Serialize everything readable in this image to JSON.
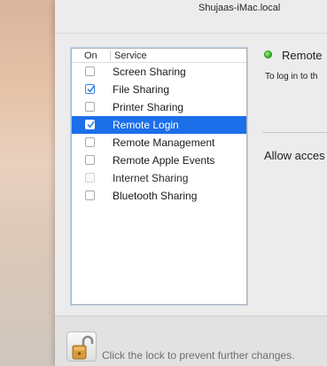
{
  "window": {
    "hostname": "Shujaas-iMac.local"
  },
  "services": {
    "header_on": "On",
    "header_service": "Service",
    "items": [
      {
        "label": "Screen Sharing",
        "checked": false
      },
      {
        "label": "File Sharing",
        "checked": true
      },
      {
        "label": "Printer Sharing",
        "checked": false
      },
      {
        "label": "Remote Login",
        "checked": true,
        "selected": true
      },
      {
        "label": "Remote Management",
        "checked": false
      },
      {
        "label": "Remote Apple Events",
        "checked": false
      },
      {
        "label": "Internet Sharing",
        "checked": false,
        "disabled": true
      },
      {
        "label": "Bluetooth Sharing",
        "checked": false
      }
    ]
  },
  "detail": {
    "status_text": "Remote",
    "status_color": "#3fbf2a",
    "login_hint": "To log in to th",
    "allow_text": "Allow acces"
  },
  "footer": {
    "lock_icon": "unlocked-padlock-icon",
    "lock_text": "Click the lock to prevent further changes."
  },
  "colors": {
    "selection": "#1b6fe8",
    "checkbox_accent": "#3d86ee"
  }
}
